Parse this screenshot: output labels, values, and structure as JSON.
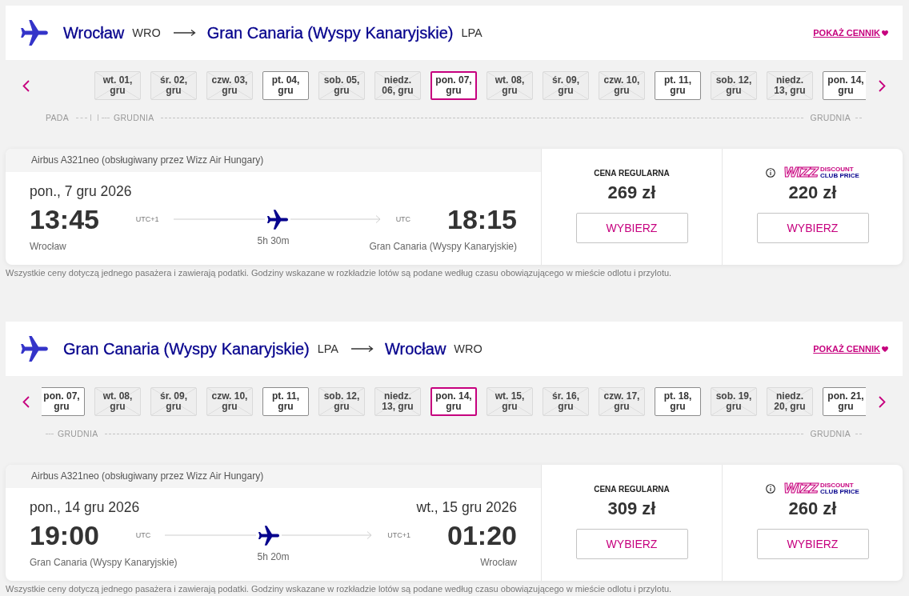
{
  "journeys": [
    {
      "origin": {
        "city": "Wrocław",
        "code": "WRO"
      },
      "destination": {
        "city": "Gran Canaria (Wyspy Kanaryjskie)",
        "code": "LPA"
      },
      "price_link": "POKAŻ CENNIK",
      "dates": [
        {
          "label": "wt. 01, gru",
          "disabled": true,
          "selected": false
        },
        {
          "label": "śr. 02, gru",
          "disabled": true,
          "selected": false
        },
        {
          "label": "czw. 03, gru",
          "disabled": true,
          "selected": false
        },
        {
          "label": "pt. 04, gru",
          "disabled": false,
          "selected": false
        },
        {
          "label": "sob. 05, gru",
          "disabled": true,
          "selected": false
        },
        {
          "label": "niedz. 06, gru",
          "disabled": true,
          "selected": false
        },
        {
          "label": "pon. 07, gru",
          "disabled": false,
          "selected": true
        },
        {
          "label": "wt. 08, gru",
          "disabled": true,
          "selected": false
        },
        {
          "label": "śr. 09, gru",
          "disabled": true,
          "selected": false
        },
        {
          "label": "czw. 10, gru",
          "disabled": true,
          "selected": false
        },
        {
          "label": "pt. 11, gru",
          "disabled": false,
          "selected": false
        },
        {
          "label": "sob. 12, gru",
          "disabled": true,
          "selected": false
        },
        {
          "label": "niedz. 13, gru",
          "disabled": true,
          "selected": false
        },
        {
          "label": "pon. 14, gru",
          "disabled": false,
          "selected": false
        }
      ],
      "months": [
        {
          "labels": [
            "PADA"
          ]
        },
        {
          "labels": [
            "GRUDNIA",
            "GRUDNIA"
          ]
        }
      ],
      "flight": {
        "aircraft": "Airbus A321neo (obsługiwany przez Wizz Air Hungary)",
        "departure": {
          "date": "pon., 7 gru 2026",
          "time": "13:45",
          "timezone": "UTC+1",
          "place": "Wrocław"
        },
        "duration": "5h 30m",
        "arrival": {
          "time": "18:15",
          "timezone": "UTC",
          "place": "Gran Canaria (Wyspy Kanaryjskie)"
        },
        "fares": [
          {
            "kind": "regular",
            "label": "CENA REGULARNA",
            "price": "269 zł",
            "button": "WYBIERZ"
          },
          {
            "kind": "club",
            "logo": {
              "wordmark": "WIZZ",
              "lines": [
                "DISCOUNT",
                "CLUB PRICE"
              ]
            },
            "price": "220 zł",
            "button": "WYBIERZ"
          }
        ]
      },
      "note": "Wszystkie ceny dotyczą jednego pasażera i zawierają podatki. Godziny wskazane w rozkładzie lotów są podane według czasu obowiązującego w mieście odlotu i przylotu."
    },
    {
      "origin": {
        "city": "Gran Canaria (Wyspy Kanaryjskie)",
        "code": "LPA"
      },
      "destination": {
        "city": "Wrocław",
        "code": "WRO"
      },
      "price_link": "POKAŻ CENNIK",
      "dates": [
        {
          "label": "pon. 07, gru",
          "disabled": false,
          "selected": false
        },
        {
          "label": "wt. 08, gru",
          "disabled": true,
          "selected": false
        },
        {
          "label": "śr. 09, gru",
          "disabled": true,
          "selected": false
        },
        {
          "label": "czw. 10, gru",
          "disabled": true,
          "selected": false
        },
        {
          "label": "pt. 11, gru",
          "disabled": false,
          "selected": false
        },
        {
          "label": "sob. 12, gru",
          "disabled": true,
          "selected": false
        },
        {
          "label": "niedz. 13, gru",
          "disabled": true,
          "selected": false
        },
        {
          "label": "pon. 14, gru",
          "disabled": false,
          "selected": true
        },
        {
          "label": "wt. 15, gru",
          "disabled": true,
          "selected": false
        },
        {
          "label": "śr. 16, gru",
          "disabled": true,
          "selected": false
        },
        {
          "label": "czw. 17, gru",
          "disabled": true,
          "selected": false
        },
        {
          "label": "pt. 18, gru",
          "disabled": false,
          "selected": false
        },
        {
          "label": "sob. 19, gru",
          "disabled": true,
          "selected": false
        },
        {
          "label": "niedz. 20, gru",
          "disabled": true,
          "selected": false
        },
        {
          "label": "pon. 21, gru",
          "disabled": false,
          "selected": false
        }
      ],
      "months": [
        {
          "labels": [
            "GRUDNIA",
            "GRUDNIA"
          ]
        }
      ],
      "flight": {
        "aircraft": "Airbus A321neo (obsługiwany przez Wizz Air Hungary)",
        "departure": {
          "date": "pon., 14 gru 2026",
          "time": "19:00",
          "timezone": "UTC",
          "place": "Gran Canaria (Wyspy Kanaryjskie)"
        },
        "duration": "5h 20m",
        "arrival": {
          "date": "wt., 15 gru 2026",
          "time": "01:20",
          "timezone": "UTC+1",
          "place": "Wrocław"
        },
        "fares": [
          {
            "kind": "regular",
            "label": "CENA REGULARNA",
            "price": "309 zł",
            "button": "WYBIERZ"
          },
          {
            "kind": "club",
            "logo": {
              "wordmark": "WIZZ",
              "lines": [
                "DISCOUNT",
                "CLUB PRICE"
              ]
            },
            "price": "260 zł",
            "button": "WYBIERZ"
          }
        ]
      },
      "note": "Wszystkie ceny dotyczą jednego pasażera i zawierają podatki. Godziny wskazane w rozkładzie lotów są podane według czasu obowiązującego w mieście odlotu i przylotu."
    }
  ]
}
